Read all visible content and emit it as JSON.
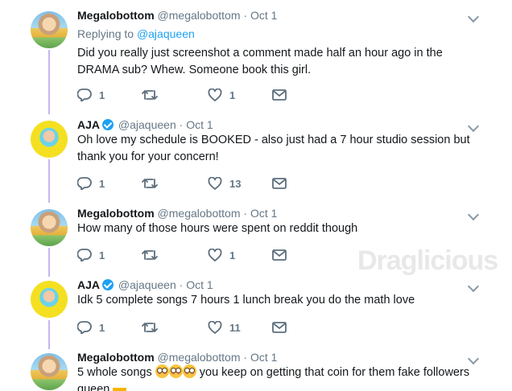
{
  "watermark": "Draglicious",
  "tweets": [
    {
      "name": "Megalobottom",
      "handle": "@megalobottom",
      "date": "Oct 1",
      "replying_prefix": "Replying to",
      "replying_to": "@ajaqueen",
      "text": "Did you really just screenshot a comment made half an hour ago in the DRAMA sub? Whew. Someone book this girl.",
      "reply_count": "1",
      "retweet_count": "",
      "like_count": "1"
    },
    {
      "name": "AJA",
      "handle": "@ajaqueen",
      "date": "Oct 1",
      "verified": true,
      "text": "Oh love my schedule is BOOKED - also just had a 7 hour studio session but thank you for your concern!",
      "reply_count": "1",
      "retweet_count": "",
      "like_count": "13"
    },
    {
      "name": "Megalobottom",
      "handle": "@megalobottom",
      "date": "Oct 1",
      "text": "How many of those hours were spent on reddit though",
      "reply_count": "1",
      "retweet_count": "",
      "like_count": "1"
    },
    {
      "name": "AJA",
      "handle": "@ajaqueen",
      "date": "Oct 1",
      "verified": true,
      "text": "Idk 5 complete songs 7 hours 1 lunch break you do the math love",
      "reply_count": "1",
      "retweet_count": "",
      "like_count": "11"
    },
    {
      "name": "Megalobottom",
      "handle": "@megalobottom",
      "date": "Oct 1",
      "text_before": "5 whole songs",
      "text_after": "you keep on getting that coin for them fake followers queen",
      "reply_count": "",
      "retweet_count": "",
      "like_count": ""
    }
  ],
  "dot": "·",
  "icons": {
    "reply": "reply-icon",
    "retweet": "retweet-icon",
    "like": "heart-icon",
    "message": "envelope-icon",
    "more": "chevron-down-icon",
    "verified": "verified-badge-icon",
    "flushed_emoji": "flushed-face-emoji",
    "crown_emoji": "crown-emoji"
  },
  "colors": {
    "thread_line": "#c9b4f0",
    "link_blue": "#1da1f2",
    "muted_gray": "#657786"
  }
}
